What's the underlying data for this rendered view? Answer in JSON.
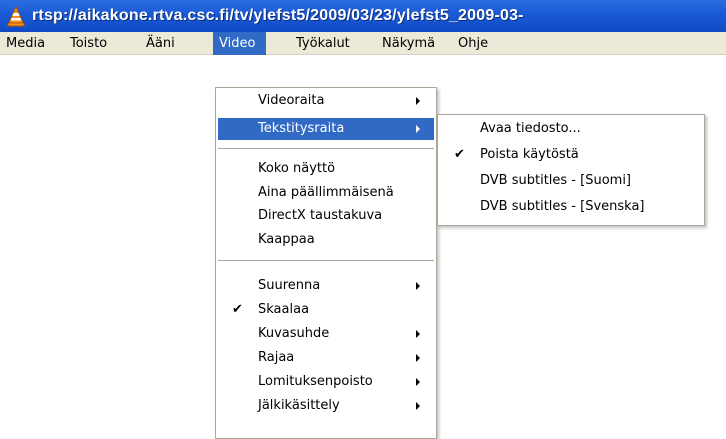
{
  "window": {
    "title": "rtsp://aikakone.rtva.csc.fi/tv/ylefst5/2009/03/23/ylefst5_2009-03-"
  },
  "menubar": {
    "items": [
      "Media",
      "Toisto",
      "Ääni",
      "Video",
      "Työkalut",
      "Näkymä",
      "Ohje"
    ],
    "active": "Video"
  },
  "video_menu": {
    "groups": [
      [
        "Videoraita",
        "Tekstitysraita"
      ],
      [
        "Koko näyttö",
        "Aina päällimmäisenä",
        "DirectX taustakuva",
        "Kaappaa"
      ],
      [
        "Suurenna",
        "Skaalaa",
        "Kuvasuhde",
        "Rajaa",
        "Lomituksenpoisto",
        "Jälkikäsittely"
      ]
    ],
    "highlighted": "Tekstitysraita",
    "checked": "Skaalaa"
  },
  "subtitle_menu": {
    "items": [
      "Avaa tiedosto...",
      "Poista käytöstä",
      "DVB subtitles - [Suomi]",
      "DVB subtitles - [Svenska]"
    ],
    "checked": "Poista käytöstä"
  },
  "glyphs": {
    "check": "✔"
  },
  "colors": {
    "titlebar": "#1c5bd6",
    "selection": "#316ac5",
    "menubar": "#ece9d8"
  },
  "icons": {
    "app": "vlc-cone-icon",
    "submenu": "submenu-arrow-icon",
    "check": "checkmark-icon"
  }
}
